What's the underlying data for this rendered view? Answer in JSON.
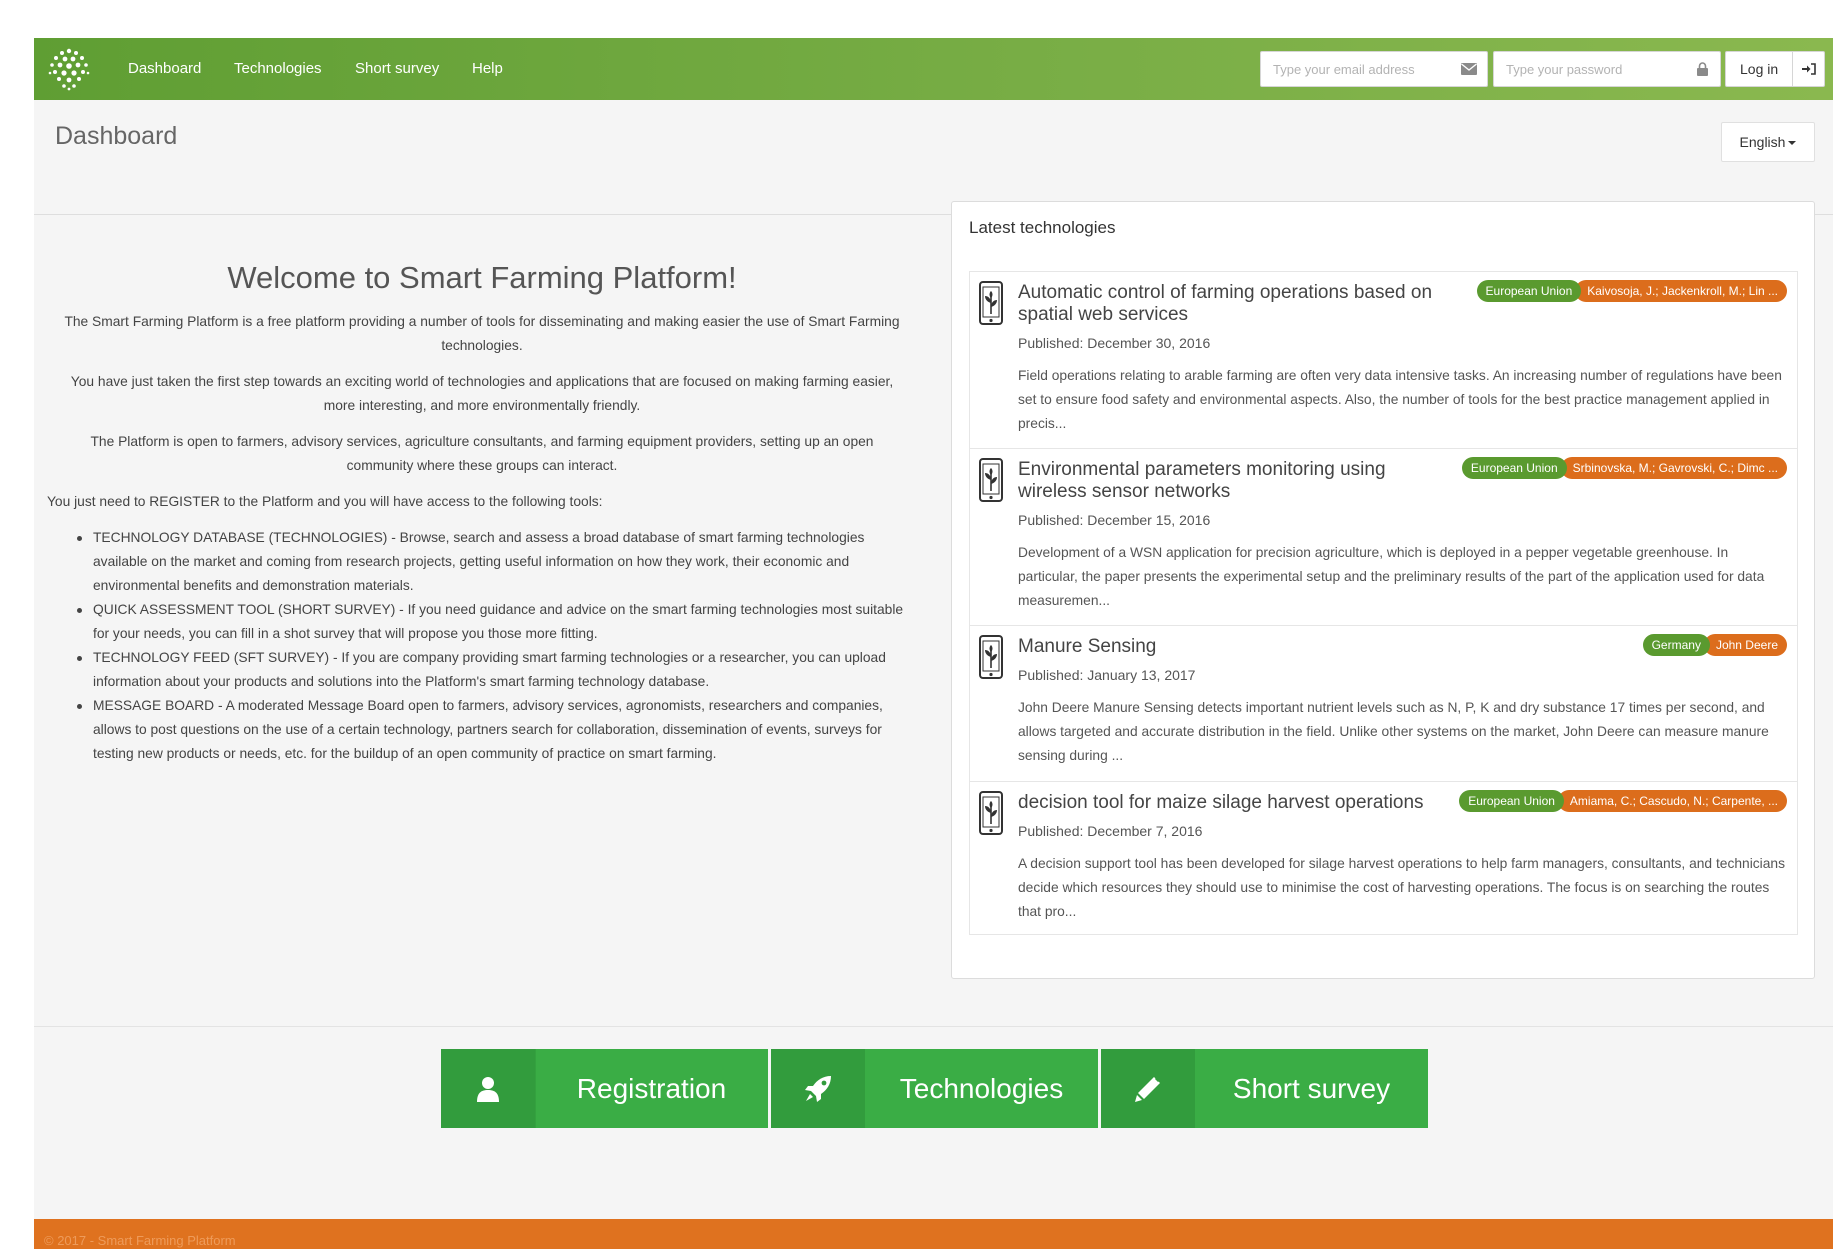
{
  "nav": {
    "items": [
      "Dashboard",
      "Technologies",
      "Short survey",
      "Help"
    ],
    "email_placeholder": "Type your email address",
    "password_placeholder": "Type your password",
    "login_label": "Log in"
  },
  "header": {
    "title": "Dashboard",
    "language": "English"
  },
  "welcome": {
    "title": "Welcome to Smart Farming Platform!",
    "paragraphs": [
      "The Smart Farming Platform is a free platform providing a number of tools for disseminating and making easier the use of Smart Farming technologies.",
      "You have just taken the first step towards an exciting world of technologies and applications that are focused on making farming easier, more interesting, and more environmentally friendly.",
      "The Platform is open to farmers, advisory services, agriculture consultants, and farming equipment providers, setting up an open community where these groups can interact."
    ],
    "intro": "You just need to REGISTER to the Platform and you will have access to the following tools:",
    "tools": [
      "TECHNOLOGY DATABASE (TECHNOLOGIES) - Browse, search and assess a broad database of smart farming technologies available on the market and coming from research projects, getting useful information on how they work, their economic and environmental benefits and demonstration materials.",
      "QUICK ASSESSMENT TOOL (SHORT SURVEY) - If you need guidance and advice on the smart farming technologies most suitable for your needs, you can fill in a shot survey that will propose you those more fitting.",
      "TECHNOLOGY FEED (SFT SURVEY) - If you are company providing smart farming technologies or a researcher, you can upload information about your products and solutions into the Platform's smart farming technology database.",
      "MESSAGE BOARD - A moderated Message Board open to farmers, advisory services, agronomists, researchers and companies, allows to post questions on the use of a certain technology, partners search for collaboration, dissemination of events, surveys for testing new products or needs, etc. for the buildup of an open community of practice on smart farming."
    ]
  },
  "latest": {
    "title": "Latest technologies",
    "items": [
      {
        "title": "Automatic control of farming operations based on spatial web services",
        "region": "European Union",
        "authors": "Kaivosoja, J.; Jackenkroll, M.; Lin ...",
        "date": "Published: December 30, 2016",
        "desc": "Field operations relating to arable farming are often very data intensive tasks. An increasing number of regulations have been set to ensure food safety and environmental aspects. Also, the number of tools for the best practice management applied in precis..."
      },
      {
        "title": "Environmental parameters monitoring using wireless sensor networks",
        "region": "European Union",
        "authors": "Srbinovska, M.; Gavrovski, C.; Dimc ...",
        "date": "Published: December 15, 2016",
        "desc": "Development of a WSN application for precision agriculture, which is deployed in a pepper vegetable greenhouse. In particular, the paper presents the experimental setup and the preliminary results of the part of the application used for data measuremen..."
      },
      {
        "title": "Manure Sensing",
        "region": "Germany",
        "authors": "John Deere",
        "date": "Published: January 13, 2017",
        "desc": "John Deere Manure Sensing detects important nutrient levels such as N, P, K and dry substance 17 times per second, and allows targeted and accurate distribution in the field. Unlike other systems on the market, John Deere can measure manure sensing during ..."
      },
      {
        "title": "decision tool for maize silage harvest operations",
        "region": "European Union",
        "authors": "Amiama, C.; Cascudo, N.; Carpente, ...",
        "date": "Published: December 7, 2016",
        "desc": "A decision support tool has been developed for silage harvest operations to help farm managers, consultants, and technicians decide which resources they should use to minimise the cost of harvesting operations. The focus is on searching the routes that pro..."
      }
    ]
  },
  "actions": {
    "registration": "Registration",
    "technologies": "Technologies",
    "short_survey": "Short survey"
  },
  "footer": {
    "text": "© 2017 - Smart Farming Platform"
  },
  "colors": {
    "nav_green": "#6aa53b",
    "action_green": "#3aad45",
    "badge_green": "#5a9a2f",
    "badge_orange": "#dc6d1c",
    "footer_orange": "#df721f"
  },
  "icons": {
    "email": "envelope-icon",
    "password": "lock-icon",
    "login": "sign-in-icon",
    "registration": "user-icon",
    "technologies": "rocket-icon",
    "short_survey": "pencil-icon",
    "tech_item": "smartphone-plant-icon"
  }
}
